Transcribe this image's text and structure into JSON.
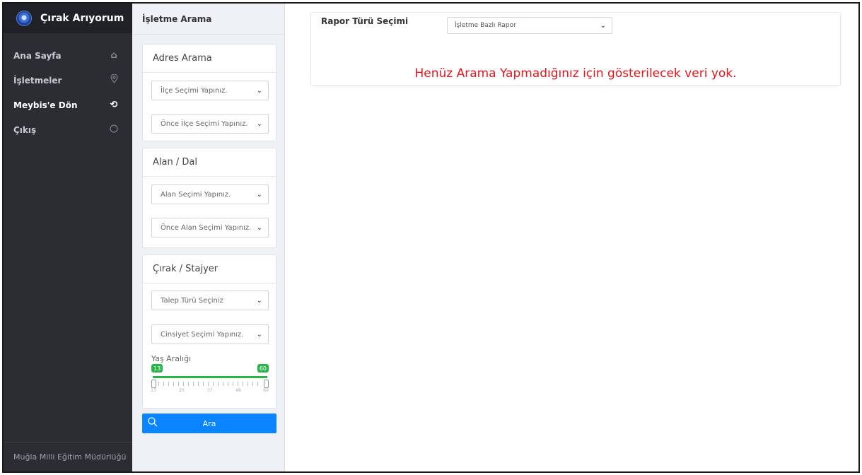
{
  "sidebar": {
    "brand": "Çırak Arıyorum",
    "items": [
      {
        "label": "Ana Sayfa",
        "icon": "home-icon"
      },
      {
        "label": "İşletmeler",
        "icon": "location-pin-icon"
      },
      {
        "label": "Meybis'e Dön",
        "icon": "history-icon"
      },
      {
        "label": "Çıkış",
        "icon": "power-icon"
      }
    ],
    "footer": "Muğla Milli Eğitim Müdürlüğü"
  },
  "filter": {
    "header": "İşletme Arama",
    "address": {
      "title": "Adres Arama",
      "district_select": "İlçe Seçimi Yapınız.",
      "neighborhood_select": "Önce İlçe Seçimi Yapınız."
    },
    "field": {
      "title": "Alan / Dal",
      "field_select": "Alan Seçimi Yapınız.",
      "branch_select": "Önce Alan Seçimi Yapınız."
    },
    "apprentice": {
      "title": "Çırak / Stajyer",
      "request_type_select": "Talep Türü Seçiniz",
      "gender_select": "Cinsiyet Seçimi Yapınız.",
      "age_range_label": "Yaş Aralığı",
      "age_min": "13",
      "age_max": "60",
      "tick_labels": [
        "13",
        "25",
        "37",
        "48",
        "60"
      ]
    },
    "search_button": "Ara"
  },
  "main": {
    "report_type_label": "Rapor Türü Seçimi",
    "report_type_value": "İşletme Bazlı Rapor",
    "no_data_message": "Henüz Arama Yapmadığınız için gösterilecek veri yok."
  },
  "colors": {
    "sidebar_bg": "#2b2d33",
    "accent_blue": "#0a84ff",
    "slider_green": "#2bb44a",
    "error_red": "#e8141c"
  }
}
